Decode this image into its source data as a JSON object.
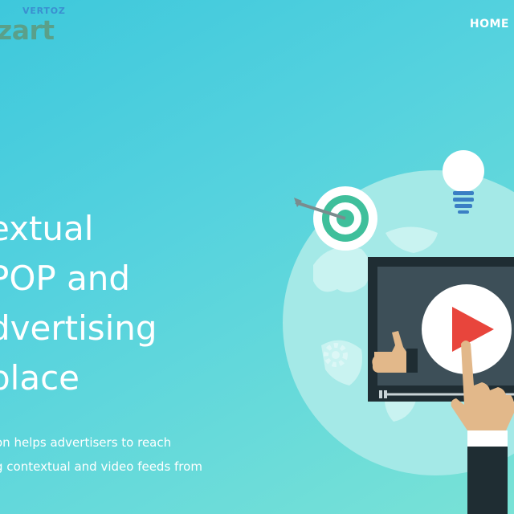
{
  "header": {
    "logo_small": "VERTOZ",
    "logo_main": "zart",
    "nav_home": "HOME"
  },
  "hero": {
    "headline_lines": [
      "extual",
      "POP and",
      "dvertising",
      "place"
    ],
    "subtitle_lines": [
      "on helps advertisers to reach",
      "g contextual and video feeds from"
    ]
  },
  "colors": {
    "background_start": "#3ec8dc",
    "background_end": "#79e2d6",
    "globe": "#a4e9e7",
    "continents": "#c9f3f1",
    "screen_frame": "#1f2d33",
    "play_red": "#e8453c",
    "target_teal": "#3fbf9b",
    "logo_text": "#5aa08a",
    "logo_small": "#3a8fd0"
  },
  "icons": [
    "lightbulb-icon",
    "target-icon",
    "arrow-icon",
    "play-icon",
    "thumbs-up-icon",
    "pointing-hand-icon",
    "gear-icon",
    "globe-icon"
  ]
}
